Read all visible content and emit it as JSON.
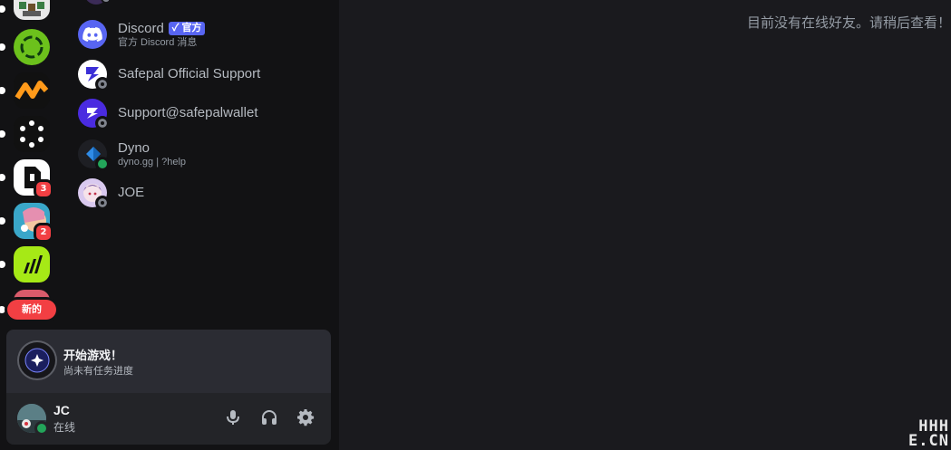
{
  "servers": {
    "new_badge": "新的",
    "items": [
      {
        "name": "server-partial-top",
        "badge": ""
      },
      {
        "name": "server-green-ring",
        "badge": ""
      },
      {
        "name": "server-orange-zigzag",
        "badge": ""
      },
      {
        "name": "server-dots",
        "badge": ""
      },
      {
        "name": "server-white-logo",
        "badge": "3"
      },
      {
        "name": "server-anime",
        "badge": "2"
      },
      {
        "name": "server-lime-chart",
        "badge": ""
      }
    ]
  },
  "dms": {
    "items": [
      {
        "name": "Discord",
        "sub": "官方 Discord 消息",
        "tag": "官方",
        "status": "none"
      },
      {
        "name": "Safepal Official Support",
        "sub": "",
        "status": "offline"
      },
      {
        "name": "Support@safepalwallet",
        "sub": "",
        "status": "offline"
      },
      {
        "name": "Dyno",
        "sub": "dyno.gg | ?help",
        "status": "online"
      },
      {
        "name": "JOE",
        "sub": "",
        "status": "offline"
      }
    ]
  },
  "main": {
    "empty_state": "目前没有在线好友。请稍后查看！"
  },
  "quest": {
    "title": "开始游戏！",
    "subtitle": "尚未有任务进度"
  },
  "user": {
    "name": "JC",
    "status": "在线"
  },
  "watermark": {
    "line1": "HHH",
    "line2": "E.CN"
  },
  "colors": {
    "accent": "#5865f2",
    "online": "#23a55a",
    "badge": "#f23f43"
  }
}
